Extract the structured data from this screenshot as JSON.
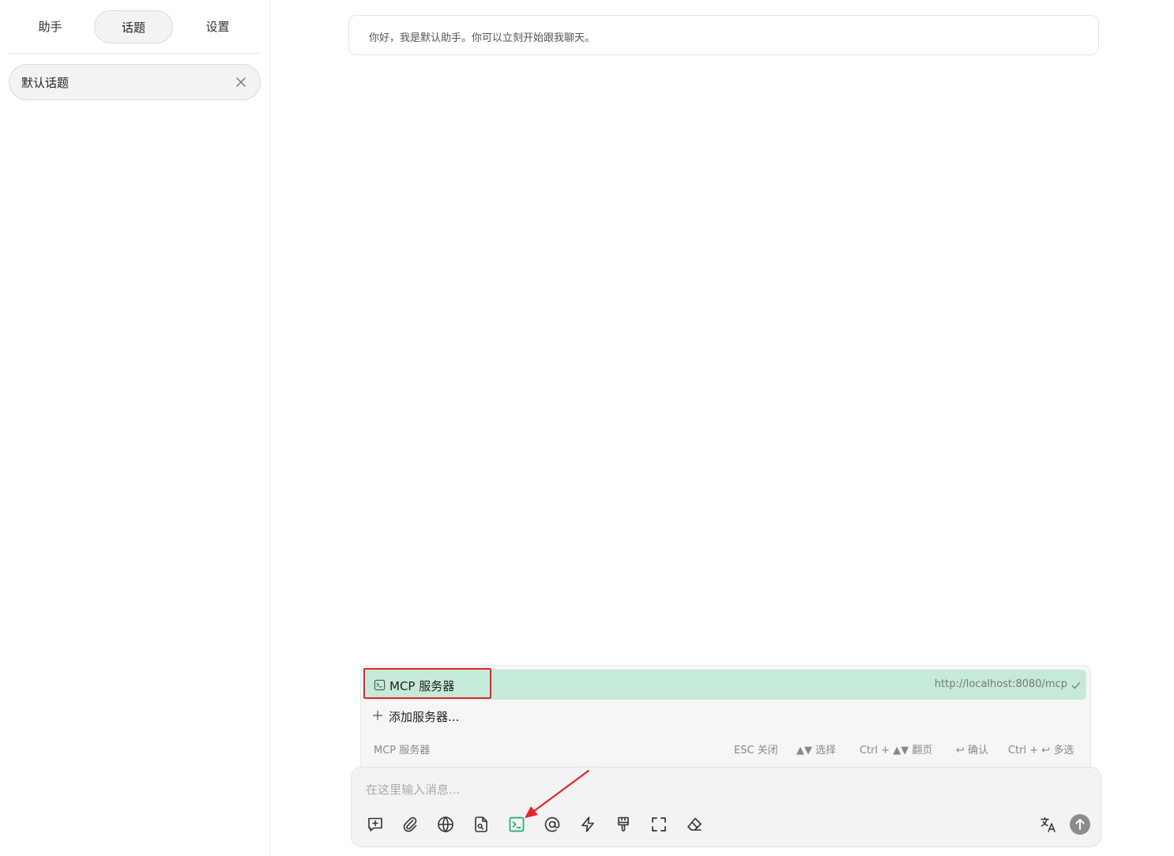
{
  "sidebar": {
    "tabs": [
      {
        "label": "助手"
      },
      {
        "label": "话题",
        "active": true
      },
      {
        "label": "设置"
      }
    ],
    "topics": [
      {
        "label": "默认话题"
      }
    ]
  },
  "chat": {
    "greeting": "你好，我是默认助手。你可以立刻开始跟我聊天。"
  },
  "mcp_popup": {
    "selected_item": {
      "icon": "terminal-icon",
      "label": "MCP 服务器",
      "url": "http://localhost:8080/mcp",
      "checked": true
    },
    "add_label": "添加服务器...",
    "footer": {
      "title": "MCP 服务器",
      "hints": {
        "esc": "ESC 关闭",
        "select": "▲▼ 选择",
        "page": "Ctrl + ▲▼ 翻页",
        "confirm": "↩ 确认",
        "multi": "Ctrl + ↩ 多选"
      }
    }
  },
  "input": {
    "placeholder": "在这里输入消息...",
    "value": ""
  },
  "toolbar": {
    "tools": [
      "new-topic-icon",
      "attachment-icon",
      "globe-icon",
      "file-search-icon",
      "terminal-icon",
      "at-icon",
      "lightning-icon",
      "brush-icon",
      "expand-icon",
      "eraser-icon"
    ],
    "right_tools": [
      "translate-icon",
      "send-icon"
    ]
  },
  "colors": {
    "accent_green": "#1fae6b",
    "selected_bg": "#c6ead8",
    "annotation_red": "#e3262b"
  }
}
